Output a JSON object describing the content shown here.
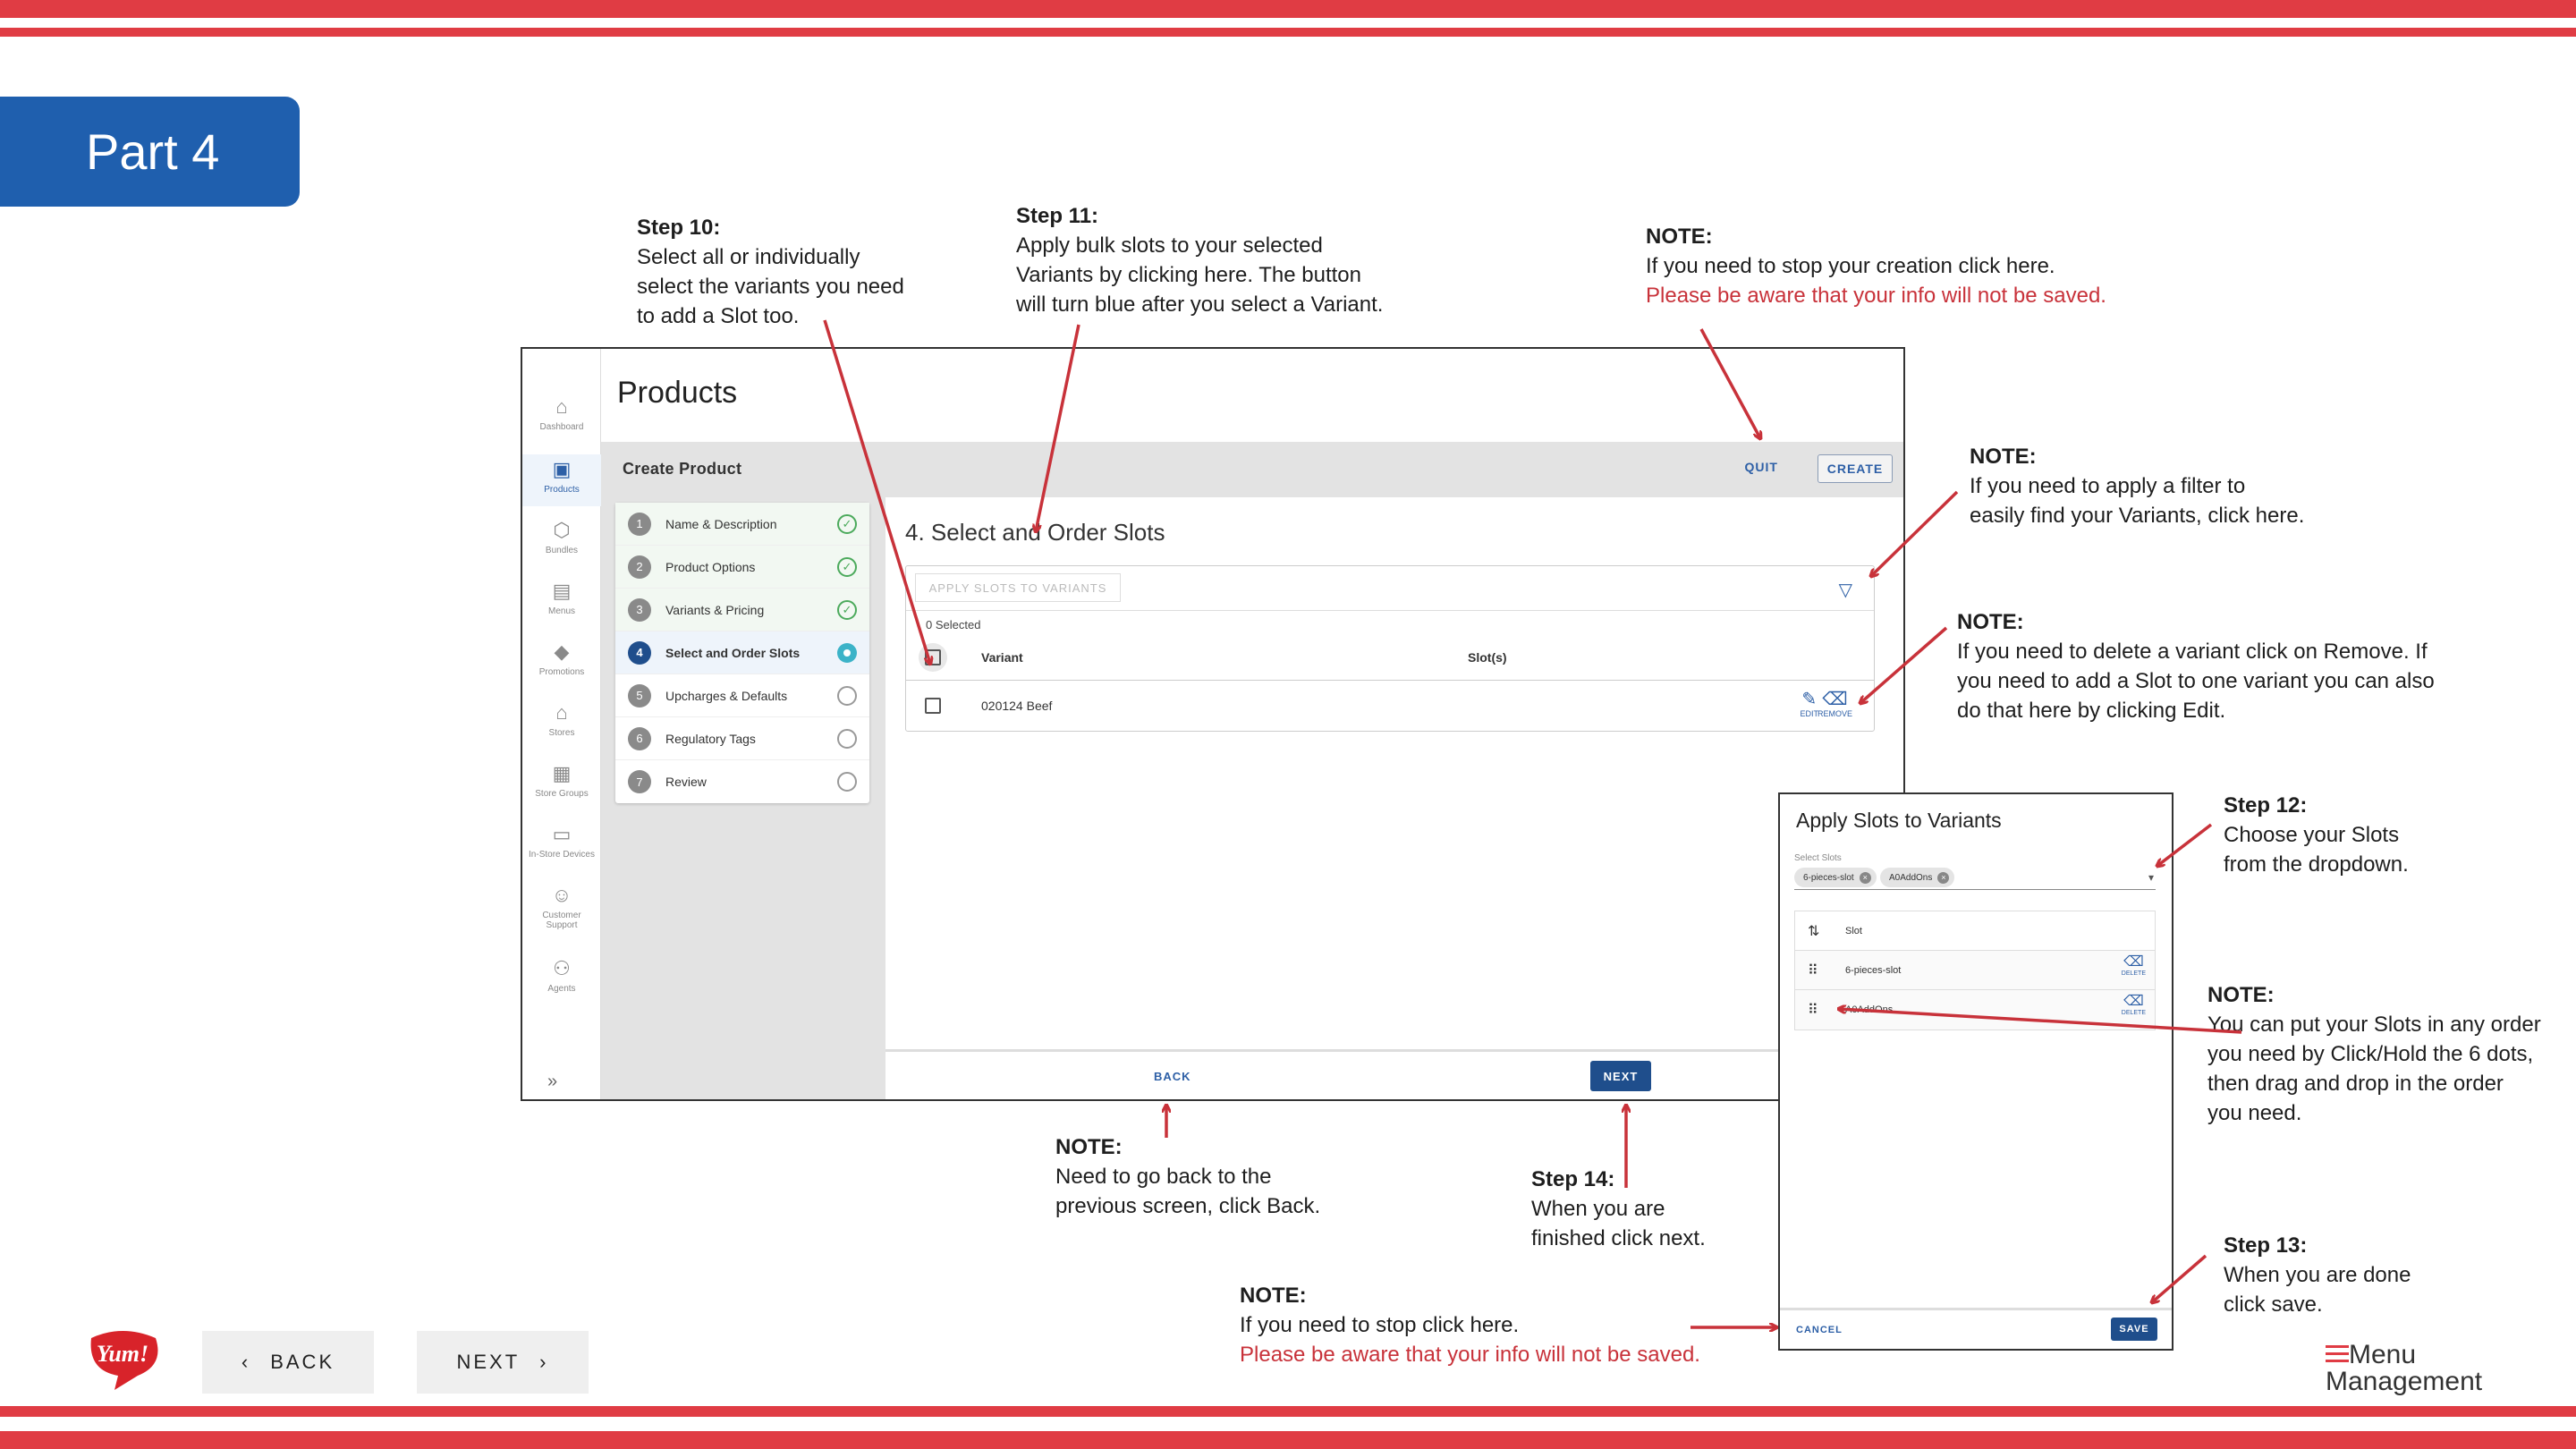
{
  "part_label": "Part 4",
  "annotations": {
    "step10": {
      "title": "Step 10:",
      "lines": [
        "Select all or individually",
        "select the variants you need",
        "to add a Slot too."
      ]
    },
    "step11": {
      "title": "Step 11:",
      "lines": [
        "Apply bulk slots to your selected",
        "Variants by clicking here. The button",
        "will turn blue after you select a Variant."
      ]
    },
    "note_quit": {
      "title": "NOTE:",
      "line": "If you need to stop your creation click here.",
      "warning": "Please be aware that your info will not be saved."
    },
    "note_filter": {
      "title": "NOTE:",
      "lines": [
        "If you need to apply a filter to",
        "easily find your Variants, click here."
      ]
    },
    "note_remove": {
      "title": "NOTE:",
      "lines": [
        "If you need to delete a variant click on Remove. If",
        "you need to add a Slot to one variant you can also",
        "do that here by clicking Edit."
      ]
    },
    "step12": {
      "title": "Step 12:",
      "lines": [
        "Choose your Slots",
        "from the dropdown."
      ]
    },
    "note_order": {
      "title": "NOTE:",
      "lines": [
        "You can put your Slots in any order",
        "you need by Click/Hold the 6 dots,",
        "then drag and drop in the order",
        "you need."
      ]
    },
    "step13": {
      "title": "Step 13:",
      "lines": [
        "When you are done",
        "click save."
      ]
    },
    "note_back": {
      "title": "NOTE:",
      "lines": [
        "Need to go back to the",
        "previous screen, click Back."
      ]
    },
    "step14": {
      "title": "Step 14:",
      "lines": [
        "When you are",
        "finished click next."
      ]
    },
    "note_cancel": {
      "title": "NOTE:",
      "line": "If you need to stop click here.",
      "warning": "Please be aware that your info will not be saved."
    }
  },
  "app": {
    "title": "Products",
    "sidebar": [
      {
        "label": "Dashboard",
        "icon": "home-icon"
      },
      {
        "label": "Products",
        "icon": "box-icon"
      },
      {
        "label": "Bundles",
        "icon": "cube-icon"
      },
      {
        "label": "Menus",
        "icon": "document-icon"
      },
      {
        "label": "Promotions",
        "icon": "tag-icon"
      },
      {
        "label": "Stores",
        "icon": "store-icon"
      },
      {
        "label": "Store Groups",
        "icon": "grid-icon"
      },
      {
        "label": "In-Store Devices",
        "icon": "monitor-icon"
      },
      {
        "label": "Customer",
        "label2": "Support",
        "icon": "headset-icon"
      },
      {
        "label": "Agents",
        "icon": "users-icon"
      }
    ],
    "create_bar": {
      "title": "Create Product",
      "quit": "QUIT",
      "create": "CREATE"
    },
    "steps": [
      {
        "num": "1",
        "label": "Name & Description"
      },
      {
        "num": "2",
        "label": "Product Options"
      },
      {
        "num": "3",
        "label": "Variants & Pricing"
      },
      {
        "num": "4",
        "label": "Select and Order Slots"
      },
      {
        "num": "5",
        "label": "Upcharges & Defaults"
      },
      {
        "num": "6",
        "label": "Regulatory Tags"
      },
      {
        "num": "7",
        "label": "Review"
      }
    ],
    "content": {
      "title": "4. Select and Order Slots",
      "apply_button": "APPLY SLOTS TO VARIANTS",
      "selected_text": "0 Selected",
      "columns": [
        "Variant",
        "Slot(s)"
      ],
      "rows": [
        {
          "variant": "020124 Beef",
          "slots": ""
        }
      ],
      "edit_label": "EDIT",
      "remove_label": "REMOVE"
    },
    "footer": {
      "back": "BACK",
      "next": "NEXT"
    }
  },
  "modal": {
    "title": "Apply Slots to Variants",
    "select_label": "Select Slots",
    "chips": [
      "6-pieces-slot",
      "A0AddOns"
    ],
    "column": "Slot",
    "rows": [
      "6-pieces-slot",
      "A0AddOns"
    ],
    "delete_label": "DELETE",
    "cancel": "CANCEL",
    "save": "SAVE"
  },
  "nav": {
    "back": "BACK",
    "next": "NEXT"
  },
  "logos": {
    "yum": "Yum!",
    "brand_line1": "Menu",
    "brand_line2": "Management"
  },
  "colors": {
    "accent_red": "#e03c44",
    "brand_blue": "#1f5fae",
    "button_blue": "#1f4e8c",
    "warning_red": "#c8323a"
  }
}
